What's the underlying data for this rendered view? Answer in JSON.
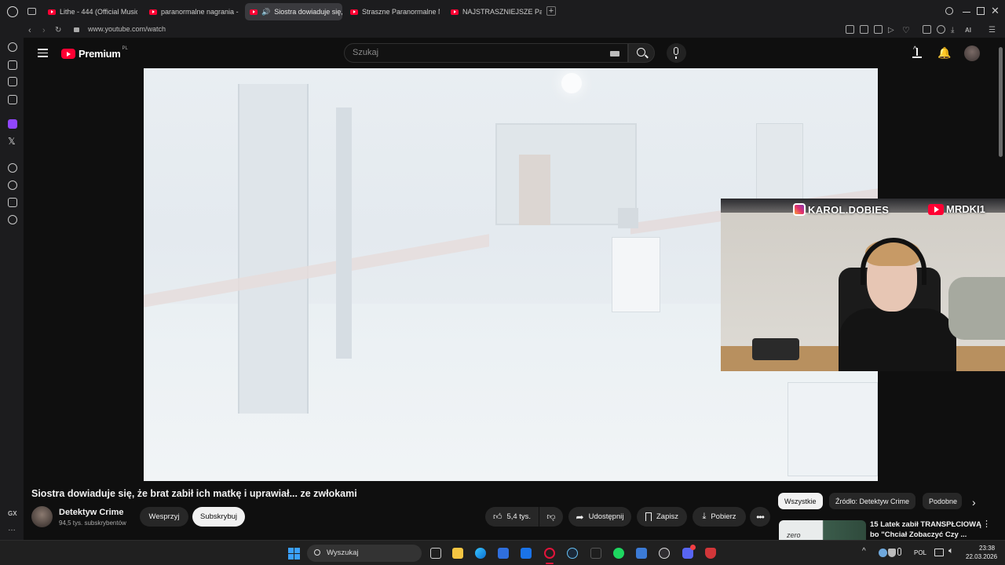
{
  "browser": {
    "tabs": [
      {
        "title": "Lithe - 444 (Official Music"
      },
      {
        "title": "paranormalne nagrania - Y"
      },
      {
        "title": "Siostra dowiaduje się,"
      },
      {
        "title": "Straszne Paranormalne N"
      },
      {
        "title": "NAJSTRASZNIEJSZE Para"
      }
    ],
    "url": "www.youtube.com/watch",
    "ai_label": "AI",
    "gx_label": "GX"
  },
  "youtube": {
    "logo_text": "Premium",
    "logo_country": "PL",
    "search_placeholder": "Szukaj",
    "video": {
      "title": "Siostra dowiaduje się, że brat zabił ich matkę i uprawiał... ze zwłokami",
      "channel_name": "Detektyw Crime",
      "subscribers": "94,5 tys. subskrybentów",
      "support_label": "Wesprzyj",
      "subscribe_label": "Subskrybuj",
      "likes": "5,4 tys.",
      "share_label": "Udostępnij",
      "save_label": "Zapisz",
      "download_label": "Pobierz"
    },
    "overlay": {
      "instagram_handle": "KAROL.DOBIES",
      "youtube_handle": "MRDKI1"
    },
    "filter_chips": [
      "Wszystkie",
      "Źródło: Detektyw Crime",
      "Podobne"
    ],
    "recommended": [
      {
        "title_line1": "15 Latek zabił TRANSPŁCIOWĄ",
        "title_line2": "bo \"Chciał Zobaczyć Czy ...",
        "thumb_text": "zero"
      }
    ]
  },
  "taskbar": {
    "search_placeholder": "Wyszukaj",
    "language": "POL",
    "time": "23:38",
    "date": "22.03.2026"
  }
}
